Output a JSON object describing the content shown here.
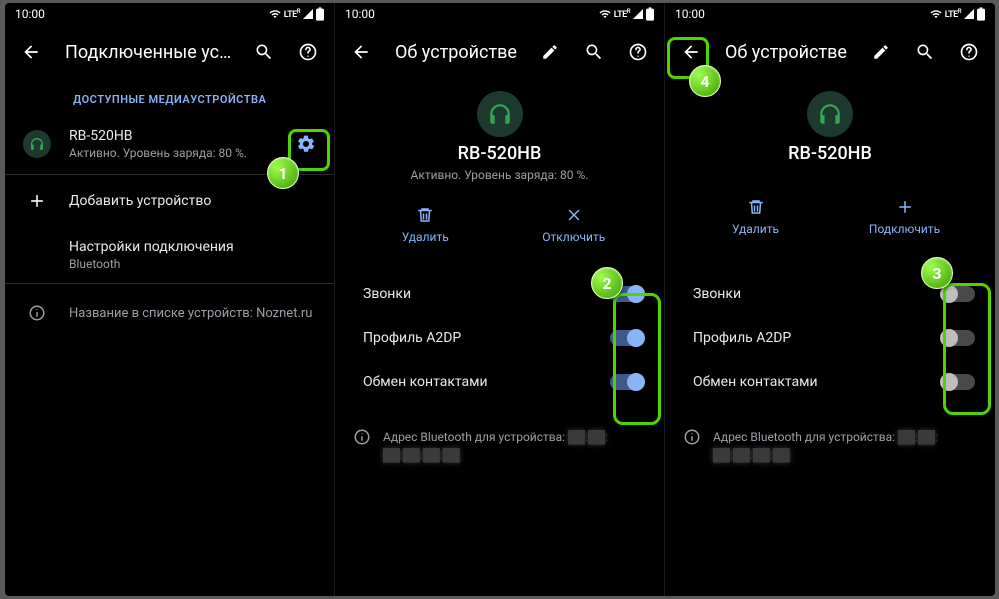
{
  "status": {
    "time": "10:00",
    "lte": "LTE",
    "lte_sup": "R"
  },
  "pane1": {
    "title": "Подключенные уст…",
    "section": "ДОСТУПНЫЕ МЕДИАУСТРОЙСТВА",
    "device": {
      "name": "RB-520HB",
      "status": "Активно. Уровень заряда: 80 %."
    },
    "add": "Добавить устройство",
    "conn": {
      "title": "Настройки подключения",
      "sub": "Bluetooth"
    },
    "info": "Название в списке устройств: Noznet.ru"
  },
  "pane2": {
    "title": "Об устройстве",
    "device": {
      "name": "RB-520HB",
      "status": "Активно. Уровень заряда: 80 %."
    },
    "actions": {
      "delete": "Удалить",
      "disconnect": "Отключить"
    },
    "toggles": {
      "calls": "Звонки",
      "a2dp": "Профиль A2DP",
      "contacts": "Обмен контактами"
    },
    "footer": "Адрес Bluetooth для устройства:"
  },
  "pane3": {
    "title": "Об устройстве",
    "device": {
      "name": "RB-520HB"
    },
    "actions": {
      "delete": "Удалить",
      "connect": "Подключить"
    },
    "toggles": {
      "calls": "Звонки",
      "a2dp": "Профиль A2DP",
      "contacts": "Обмен контактами"
    },
    "footer": "Адрес Bluetooth для устройства:"
  },
  "callouts": {
    "c1": "1",
    "c2": "2",
    "c3": "3",
    "c4": "4"
  }
}
